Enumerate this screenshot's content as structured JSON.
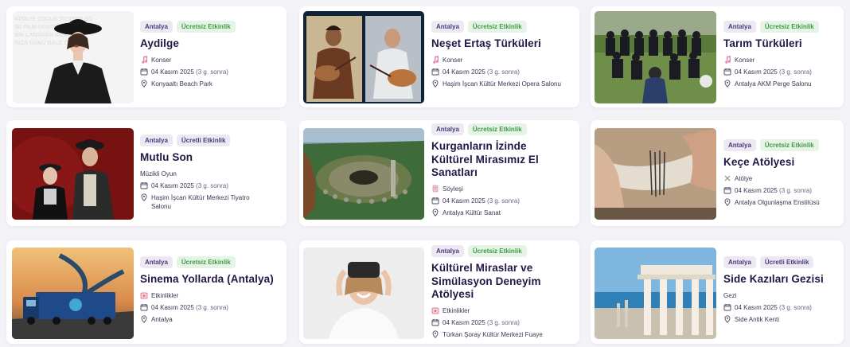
{
  "events": [
    {
      "city": "Antalya",
      "price": "Ücretsiz Etkinlik",
      "price_type": "free",
      "title": "Aydilge",
      "category": "Konser",
      "category_icon": "music-note-icon",
      "date": "04 Kasım 2025",
      "date_rel": "(3 g. sonra)",
      "venue": "Konyaaltı Beach Park"
    },
    {
      "city": "Antalya",
      "price": "Ücretsiz Etkinlik",
      "price_type": "free",
      "title": "Neşet Ertaş Türküleri",
      "category": "Konser",
      "category_icon": "music-note-icon",
      "date": "04 Kasım 2025",
      "date_rel": "(3 g. sonra)",
      "venue": "Haşim İşcan Kültür Merkezi Opera Salonu"
    },
    {
      "city": "Antalya",
      "price": "Ücretsiz Etkinlik",
      "price_type": "free",
      "title": "Tarım Türküleri",
      "category": "Konser",
      "category_icon": "music-note-icon",
      "date": "04 Kasım 2025",
      "date_rel": "(3 g. sonra)",
      "venue": "Antalya AKM Perge Salonu"
    },
    {
      "city": "Antalya",
      "price": "Ücretli Etkinlik",
      "price_type": "paid",
      "title": "Mutlu Son",
      "category": "Müzikli Oyun",
      "category_icon": "",
      "date": "04 Kasım 2025",
      "date_rel": "(3 g. sonra)",
      "venue": "Haşim İşcan Kültür Merkezi Tiyatro Salonu"
    },
    {
      "city": "Antalya",
      "price": "Ücretsiz Etkinlik",
      "price_type": "free",
      "title": "Kurganların İzinde Kültürel Mirasımız El Sanatları",
      "category": "Söyleşi",
      "category_icon": "document-icon",
      "date": "04 Kasım 2025",
      "date_rel": "(3 g. sonra)",
      "venue": "Antalya Kültür Sanat"
    },
    {
      "city": "Antalya",
      "price": "Ücretsiz Etkinlik",
      "price_type": "free",
      "title": "Keçe Atölyesi",
      "category": "Atölye",
      "category_icon": "tools-icon",
      "date": "04 Kasım 2025",
      "date_rel": "(3 g. sonra)",
      "venue": "Antalya Olgunlaşma Enstitüsü"
    },
    {
      "city": "Antalya",
      "price": "Ücretsiz Etkinlik",
      "price_type": "free",
      "title": "Sinema Yollarda (Antalya)",
      "category": "Etkinlikler",
      "category_icon": "calendar-star-icon",
      "date": "04 Kasım 2025",
      "date_rel": "(3 g. sonra)",
      "venue": "Antalya"
    },
    {
      "city": "Antalya",
      "price": "Ücretsiz Etkinlik",
      "price_type": "free",
      "title": "Kültürel Miraslar ve Simülasyon Deneyim Atölyesi",
      "category": "Etkinlikler",
      "category_icon": "calendar-star-icon",
      "date": "04 Kasım 2025",
      "date_rel": "(3 g. sonra)",
      "venue": "Türkan Şoray Kültür Merkezi Fuaye"
    },
    {
      "city": "Antalya",
      "price": "Ücretli Etkinlik",
      "price_type": "paid",
      "title": "Side Kazıları Gezisi",
      "category": "Gezi",
      "category_icon": "",
      "date": "04 Kasım 2025",
      "date_rel": "(3 g. sonra)",
      "venue": "Side Antik Kenti"
    }
  ]
}
